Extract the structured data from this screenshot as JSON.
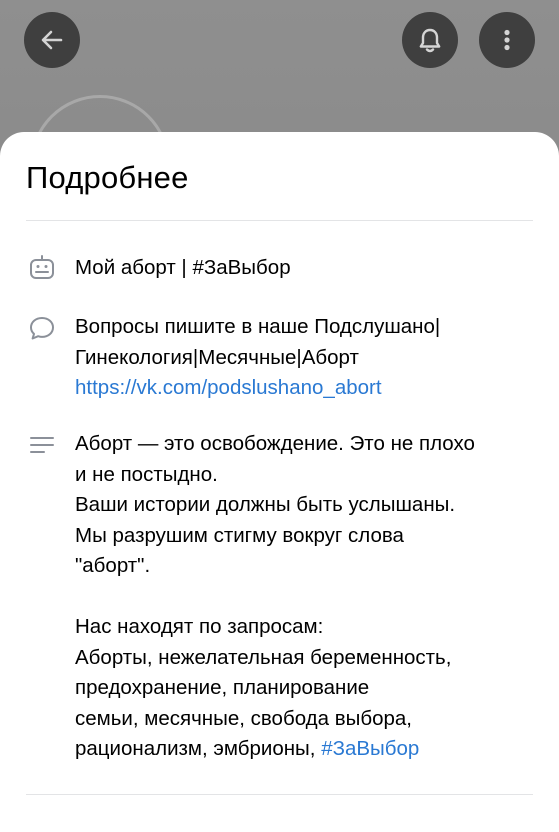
{
  "header": {
    "back_icon": "arrow-left-icon",
    "bell_icon": "bell-icon",
    "more_icon": "more-vertical-icon"
  },
  "sheet": {
    "title": "Подробнее",
    "status": {
      "icon": "status-badge-icon",
      "text": "Мой аборт | #ЗаВыбор"
    },
    "contact": {
      "icon": "chat-bubble-icon",
      "line1": "Вопросы пишите в наше Подслушано|",
      "line2": "Гинекология|Месячные|Аборт",
      "link": "https://vk.com/podslushano_abort"
    },
    "description": {
      "icon": "text-lines-icon",
      "lines": [
        "Аборт — это освобождение. Это не плохо",
        "и не постыдно.",
        "Ваши истории должны быть услышаны.",
        "Мы разрушим стигму вокруг слова",
        "\"аборт\"."
      ],
      "search_title": "Нас находят по запросам:",
      "search_lines": [
        "Аборты, нежелательная беременность,",
        "предохранение, планирование",
        "семьи, месячные, свобода выбора,"
      ],
      "last_line_text": "рационализм, эмбрионы, ",
      "hashtag": "#ЗаВыбор"
    }
  },
  "colors": {
    "accent": "#2a79d3",
    "icon": "#8b9099",
    "backdrop": "#8e8e8e",
    "button": "#3f3f3f"
  }
}
